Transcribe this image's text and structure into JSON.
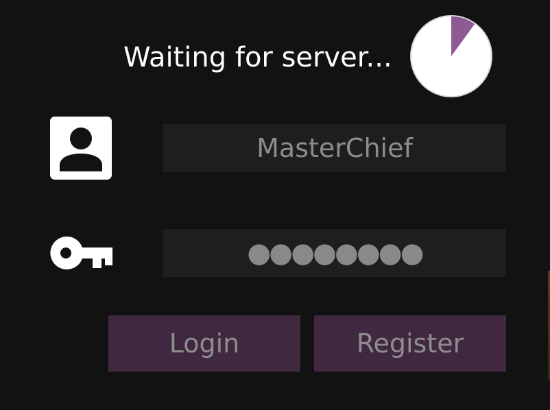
{
  "status": {
    "text": "Waiting for server..."
  },
  "timer": {
    "progress": 0.1,
    "fill_color": "#8d5a94",
    "face_color": "#ffffff"
  },
  "login_form": {
    "username_icon": "user-icon",
    "username_value": "MasterChief",
    "password_icon": "key-icon",
    "password_mask": "●●●●●●●●",
    "login_label": "Login",
    "register_label": "Register"
  },
  "colors": {
    "background": "#131213",
    "field_background": "#1f1e1f",
    "button_background": "#3f2840",
    "muted_text": "#8e8c8e"
  }
}
